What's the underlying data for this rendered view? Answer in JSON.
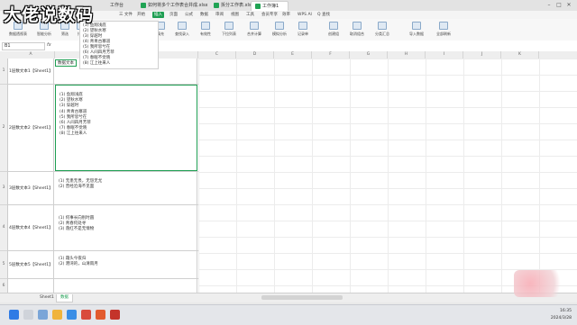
{
  "watermark": "大佬说数码",
  "file_tabs": [
    {
      "label": "工作台"
    },
    {
      "label": "如何将多个工作表合并成.xlsx"
    },
    {
      "label": "拆分工作表.xlsx"
    },
    {
      "label": "工作簿1"
    }
  ],
  "menus": [
    "三 文件",
    "开始",
    "插入",
    "页面",
    "公式",
    "数据",
    "审阅",
    "视图",
    "工具",
    "会员专享",
    "效率",
    "WPS AI",
    "Q 查找"
  ],
  "ribbon": [
    {
      "label": "数据透视表"
    },
    {
      "label": "智能分析"
    },
    {
      "label": "筛选"
    },
    {
      "label": "排序"
    },
    {
      "label": "重复项"
    },
    {
      "label": "数据对比"
    },
    {
      "label": "分列"
    },
    {
      "label": "填充"
    },
    {
      "label": "查找录入"
    },
    {
      "label": "有效性"
    },
    {
      "label": "下拉列表"
    },
    {
      "label": "合并计算"
    },
    {
      "label": "模拟分析"
    },
    {
      "label": "记录单"
    },
    {
      "label": "创建组"
    },
    {
      "label": "取消组合"
    },
    {
      "label": "分类汇总"
    },
    {
      "label": "导入数据"
    },
    {
      "label": "全部刷新"
    }
  ],
  "formula_bar": {
    "name_box": "B1",
    "fx": "fx"
  },
  "columns": [
    "A",
    "B",
    "C",
    "D",
    "E",
    "F",
    "G",
    "H",
    "I",
    "J",
    "K"
  ],
  "overlay_lines": [
    "(1) 鱼翔浅底",
    "(2) 望秋水寒",
    "(3) 穿越时",
    "(4) 青青古寨道",
    "(5) 我所思兮在",
    "(6) 人间四月芳菲",
    "(7) 春眠不觉晓",
    "(8) 江上往来人"
  ],
  "b1_header": "数据文本",
  "rows": [
    {
      "num": "1",
      "a": "1层数文本1【Sheet1】",
      "lines": []
    },
    {
      "num": "2",
      "a": "2层数文本2【Sheet1】",
      "lines": [
        "(1) 鱼翔浅底",
        "(2) 望秋水寒",
        "(3) 穿越时",
        "(4) 青青古寨道",
        "(5) 我所思兮在",
        "(6) 人间四月芳菲",
        "(7) 春眠不觉晓",
        "(8) 江上往来人"
      ]
    },
    {
      "num": "3",
      "a": "3层数文本3【Sheet1】",
      "lines": [
        "(1) 无患无畏，无怨无尤",
        "(2) 曾经沧海不见面"
      ]
    },
    {
      "num": "4",
      "a": "4层数文本4【Sheet1】",
      "lines": [
        "(1) 何事长向别时圆",
        "(2) 青春何处寻",
        "(3) 落红不是无情物"
      ]
    },
    {
      "num": "5",
      "a": "5层数文本5【Sheet1】",
      "lines": [
        "(1) 霜头今夜归",
        "(2) 港湾的，山清雨月"
      ]
    },
    {
      "num": "6",
      "a": "",
      "lines": []
    }
  ],
  "sheet_tabs": [
    "Sheet1",
    "数据"
  ],
  "tray": {
    "time": "16:35",
    "date": "2024/3/28"
  }
}
